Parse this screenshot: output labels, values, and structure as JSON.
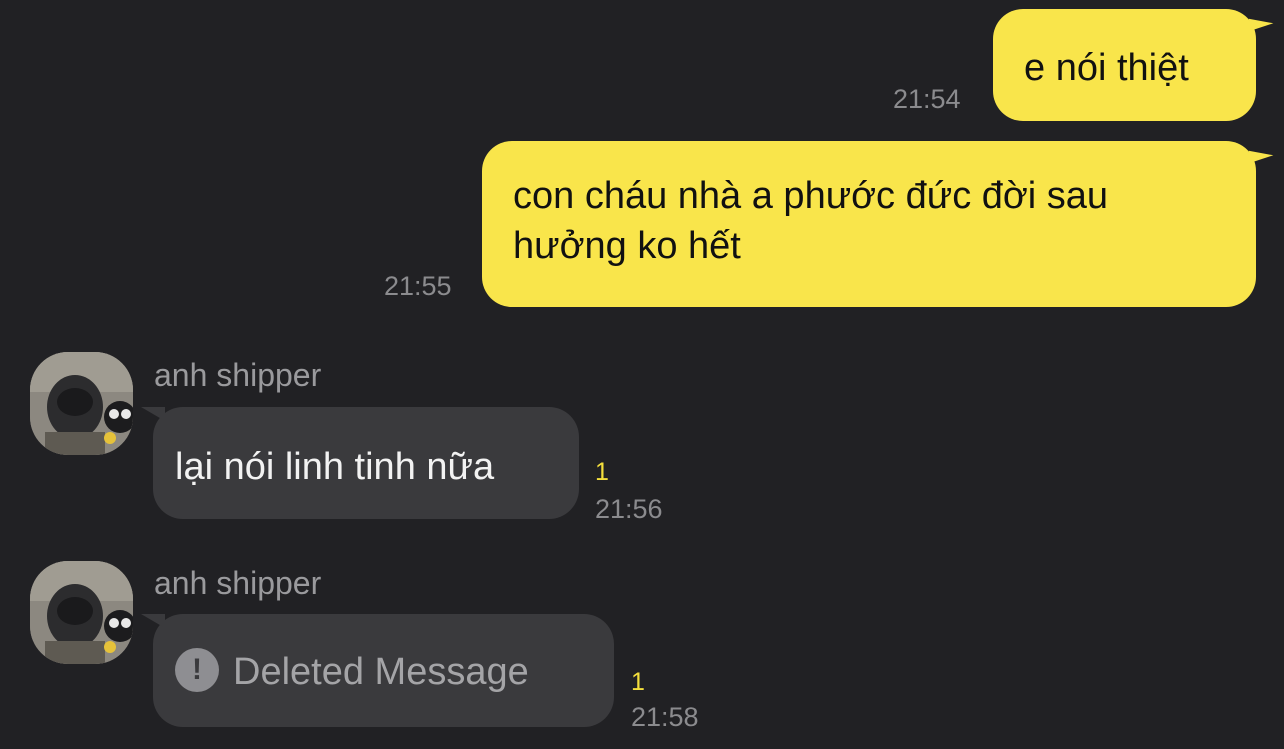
{
  "messages": [
    {
      "direction": "out",
      "text": "e nói thiệt",
      "time": "21:54"
    },
    {
      "direction": "out",
      "text_line1": "con cháu nhà a phước đức đời sau",
      "text_line2": "hưởng ko hết",
      "time": "21:55"
    },
    {
      "direction": "in",
      "sender": "anh shipper",
      "text": "lại nói linh tinh nữa",
      "unread": "1",
      "time": "21:56"
    },
    {
      "direction": "in",
      "sender": "anh shipper",
      "text": "Deleted Message",
      "unread": "1",
      "time": "21:58",
      "icon": "exclamation-icon"
    }
  ],
  "colors": {
    "background": "#212124",
    "outgoing_bubble": "#F9E54B",
    "incoming_bubble": "#3A3A3D",
    "unread_count": "#F4DF3C",
    "timestamp": "#8B8B8E"
  }
}
